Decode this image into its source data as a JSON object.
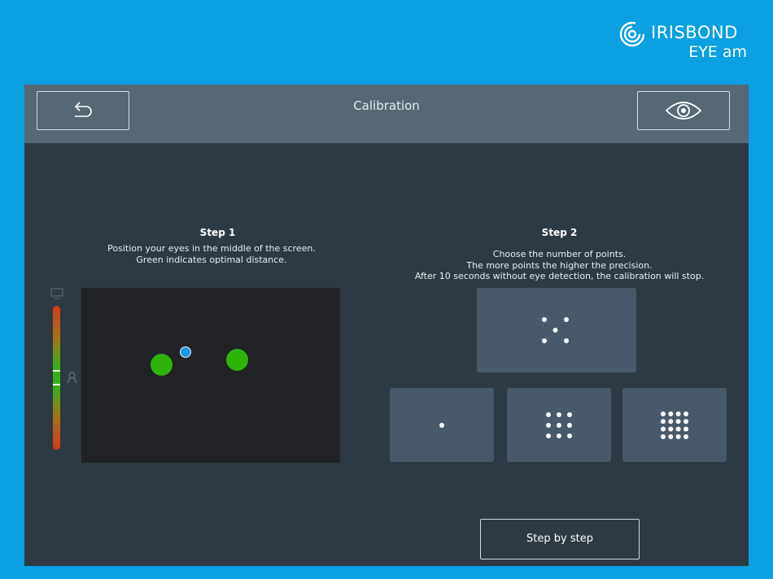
{
  "brand": {
    "name": "IRISBOND",
    "product": "EYE am",
    "logo_icon": "irisbond-spiral-logo"
  },
  "header": {
    "title": "Calibration",
    "back_icon": "undo-arrow-icon",
    "eye_icon": "eye-icon"
  },
  "step1": {
    "title": "Step 1",
    "lines": [
      "Position your eyes in the middle of the screen.",
      "Green indicates optimal distance."
    ],
    "distance_indicator": {
      "top_icon": "monitor-icon",
      "bottom_icon": "person-icon"
    }
  },
  "step2": {
    "title": "Step 2",
    "lines": [
      "Choose the number of points.",
      "The more points the higher the precision.",
      "After 10 seconds without eye detection, the calibration will stop."
    ],
    "options": [
      {
        "points": 5
      },
      {
        "points": 1
      },
      {
        "points": 9
      },
      {
        "points": 16
      }
    ]
  },
  "footer": {
    "step_by_step_label": "Step by step"
  },
  "colors": {
    "background": "#0aa0e2",
    "panel": "#2d3a43",
    "header": "#566874",
    "option_tile": "#48596a",
    "eye_green": "#2db40b",
    "gaze_blue": "#1d98dc"
  }
}
